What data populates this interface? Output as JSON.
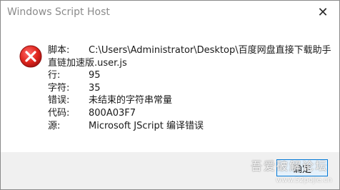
{
  "window": {
    "title": "Windows Script Host",
    "close_glyph": "✕"
  },
  "error": {
    "icon": "error-x-icon",
    "rows": [
      {
        "label": "脚本:",
        "value": "C:\\Users\\Administrator\\Desktop\\百度网盘直接下载助手"
      },
      {
        "label": "",
        "value": "直链加速版.user.js"
      },
      {
        "label": "行:",
        "value": "95"
      },
      {
        "label": "字符:",
        "value": "35"
      },
      {
        "label": "错误:",
        "value": "未结束的字符串常量"
      },
      {
        "label": "代码:",
        "value": "800A03F7"
      },
      {
        "label": "源:",
        "value": "Microsoft JScript 编译错误"
      }
    ]
  },
  "footer": {
    "ok_label": "确定"
  },
  "watermark": {
    "text": "吾爱破解论坛",
    "sub": "www.52pojie.cn"
  },
  "colors": {
    "accent": "#0078d7",
    "error_red": "#e81123"
  }
}
